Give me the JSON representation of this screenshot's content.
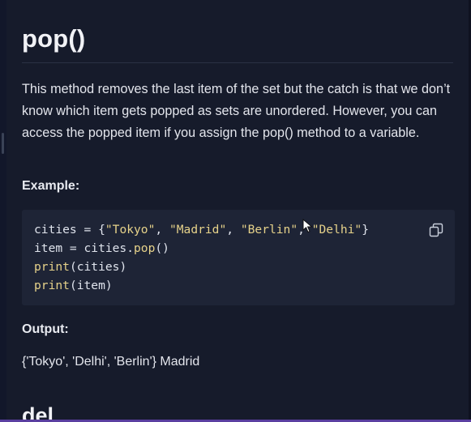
{
  "section": {
    "title": "pop()",
    "description": "This method removes the last item of the set but the catch is that we don’t know which item gets popped as sets are unordered. However, you can access the popped item if you assign the pop() method to a variable."
  },
  "example": {
    "label": "Example:",
    "code": {
      "line1": {
        "var": "cities",
        "op": " = {",
        "s1": "\"Tokyo\"",
        "c1": ", ",
        "s2": "\"Madrid\"",
        "c2": ", ",
        "s3": "\"Berlin\"",
        "c3": ", ",
        "s4": "\"Delhi\"",
        "close": "}"
      },
      "line2": {
        "left": "item = cities.",
        "fn": "pop",
        "right": "()"
      },
      "line3": {
        "fn": "print",
        "args": "(cities)"
      },
      "line4": {
        "fn": "print",
        "args": "(item)"
      }
    },
    "copy_icon": "copy-icon"
  },
  "output": {
    "label": "Output:",
    "text": "{'Tokyo', 'Delhi', 'Berlin'} Madrid"
  },
  "next_section": {
    "title": "del"
  },
  "colors": {
    "background": "#161b2b",
    "code_background": "#1e2436",
    "string": "#e6d28a",
    "accent_bottom": "#5a3fa0"
  }
}
